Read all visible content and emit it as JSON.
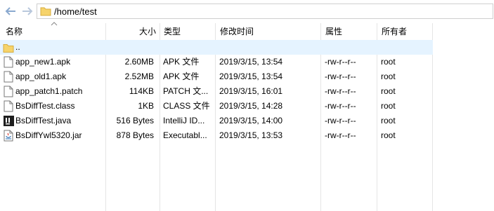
{
  "address": {
    "path": "/home/test"
  },
  "columns": {
    "name": "名称",
    "size": "大小",
    "type": "类型",
    "modified": "修改时间",
    "attributes": "属性",
    "owner": "所有者"
  },
  "parent_row": {
    "name": ".."
  },
  "files": [
    {
      "name": "app_new1.apk",
      "size": "2.60MB",
      "type": "APK 文件",
      "modified": "2019/3/15, 13:54",
      "attributes": "-rw-r--r--",
      "owner": "root",
      "icon": "document-icon"
    },
    {
      "name": "app_old1.apk",
      "size": "2.52MB",
      "type": "APK 文件",
      "modified": "2019/3/15, 13:54",
      "attributes": "-rw-r--r--",
      "owner": "root",
      "icon": "document-icon"
    },
    {
      "name": "app_patch1.patch",
      "size": "114KB",
      "type": "PATCH 文...",
      "modified": "2019/3/15, 16:01",
      "attributes": "-rw-r--r--",
      "owner": "root",
      "icon": "document-icon"
    },
    {
      "name": "BsDiffTest.class",
      "size": "1KB",
      "type": "CLASS 文件",
      "modified": "2019/3/15, 14:28",
      "attributes": "-rw-r--r--",
      "owner": "root",
      "icon": "document-icon"
    },
    {
      "name": "BsDiffTest.java",
      "size": "516 Bytes",
      "type": "IntelliJ ID...",
      "modified": "2019/3/15, 14:00",
      "attributes": "-rw-r--r--",
      "owner": "root",
      "icon": "intellij-icon"
    },
    {
      "name": "BsDiffYwl5320.jar",
      "size": "878 Bytes",
      "type": "Executabl...",
      "modified": "2019/3/15, 13:53",
      "attributes": "-rw-r--r--",
      "owner": "root",
      "icon": "jar-icon"
    }
  ],
  "colors": {
    "selection": "#e5f3ff",
    "folder": "#f6d36b",
    "separator": "#e5e5e5"
  }
}
